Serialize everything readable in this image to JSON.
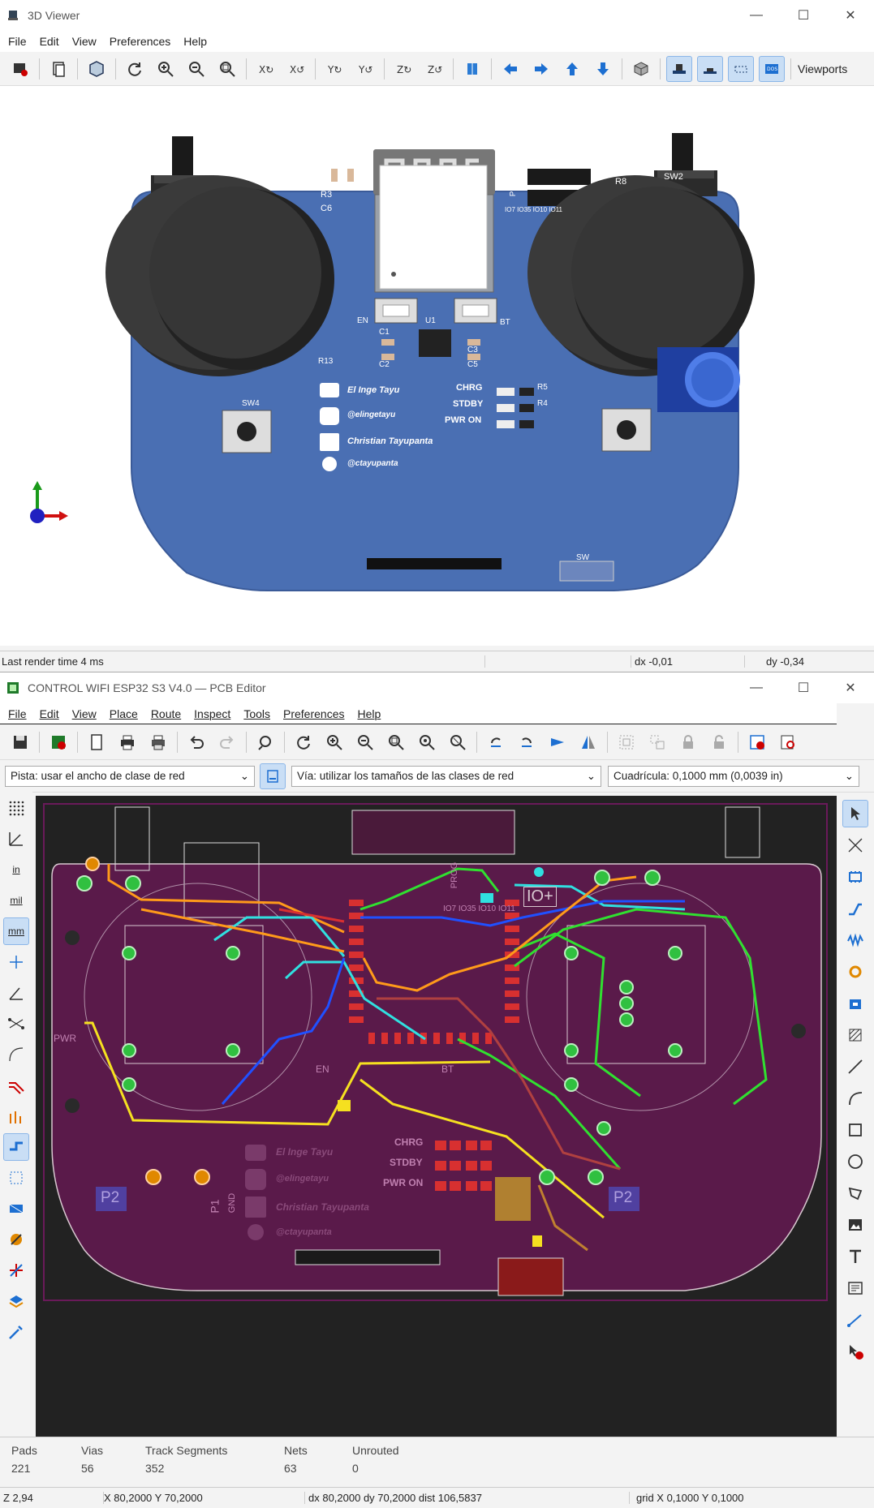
{
  "viewer": {
    "title": "3D Viewer",
    "menu": [
      "File",
      "Edit",
      "View",
      "Preferences",
      "Help"
    ],
    "viewports_label": "Viewports",
    "status": {
      "render": "Last render time 4 ms",
      "dx": "dx -0,01",
      "dy": "dy -0,34"
    },
    "board_text": {
      "r3": "R3",
      "c6": "C6",
      "r8": "R8",
      "sw2": "SW2",
      "prog": "PROG",
      "pinrow": "IO7 IO35 IO10 IO11",
      "en": "EN",
      "bt": "BT",
      "u1": "U1",
      "c1": "C1",
      "c2": "C2",
      "c3": "C3",
      "c5": "C5",
      "r13": "R13",
      "sw4": "SW4",
      "sw": "SW",
      "chrg": "CHRG",
      "stdby": "STDBY",
      "pwr_on": "PWR ON",
      "r5": "R5",
      "r4": "R4",
      "social1": "El Inge Tayu",
      "social2": "@elingetayu",
      "social3": "Christian Tayupanta",
      "social4": "@ctayupanta"
    }
  },
  "editor": {
    "title": "CONTROL WIFI ESP32 S3 V4.0 — PCB Editor",
    "menu": [
      "File",
      "Edit",
      "View",
      "Place",
      "Route",
      "Inspect",
      "Tools",
      "Preferences",
      "Help"
    ],
    "track_select": "Pista: usar el ancho de clase de red",
    "via_select": "Vía: utilizar los tamaños de las clases de red",
    "grid_select": "Cuadrícula: 0,1000 mm (0,0039 in)",
    "left_tool_labels": {
      "in": "in",
      "mil": "mil",
      "mm": "mm"
    },
    "board_text": {
      "prog": "PROG",
      "pinrow": "IO7 IO35 IO10 IO11",
      "io_plus": "IO+",
      "pwr": "PWR",
      "en": "EN",
      "bt": "BT",
      "p1": "P1",
      "gnd": "GND",
      "p2": "P2",
      "chrg": "CHRG",
      "stdby": "STDBY",
      "pwr_on": "PWR ON",
      "social1": "El Inge Tayu",
      "social2": "@elingetayu",
      "social3": "Christian Tayupanta",
      "social4": "@ctayupanta"
    },
    "stats": [
      {
        "label": "Pads",
        "value": "221"
      },
      {
        "label": "Vias",
        "value": "56"
      },
      {
        "label": "Track Segments",
        "value": "352"
      },
      {
        "label": "Nets",
        "value": "63"
      },
      {
        "label": "Unrouted",
        "value": "0"
      }
    ],
    "status": {
      "zoom": "Z 2,94",
      "xy": "X 80,2000  Y 70,2000",
      "delta": "dx 80,2000  dy 70,2000  dist 106,5837",
      "grid": "grid X 0,1000  Y 0,1000"
    }
  }
}
